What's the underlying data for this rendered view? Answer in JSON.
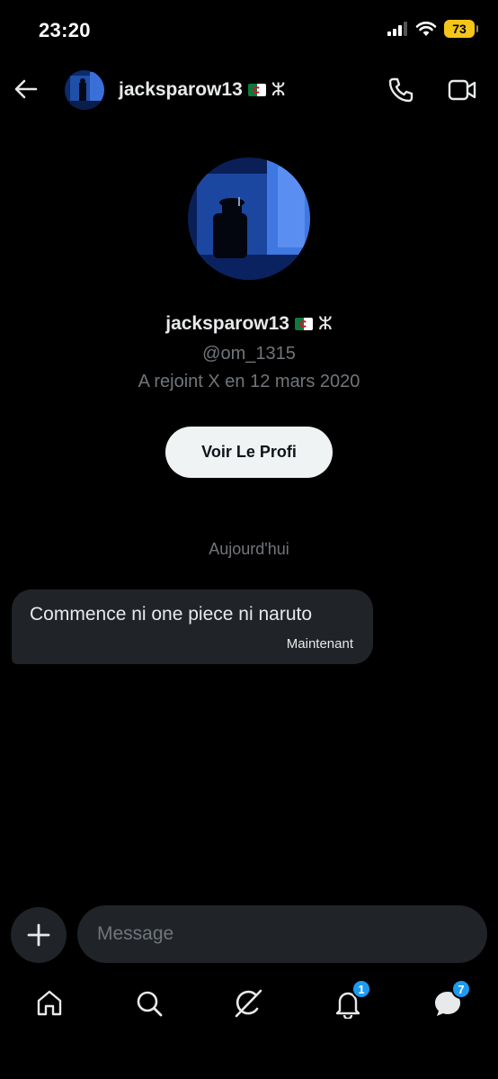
{
  "status_bar": {
    "time": "23:20",
    "battery": "73",
    "icons": [
      "signal-icon",
      "wifi-icon",
      "battery-icon"
    ]
  },
  "header": {
    "name": "jacksparow13",
    "flag": "algeria-flag",
    "symbol": "ⵣ",
    "icons": [
      "back-arrow-icon",
      "phone-icon",
      "video-icon"
    ]
  },
  "profile": {
    "name": "jacksparow13",
    "symbol": "ⵣ",
    "handle": "@om_1315",
    "joined": "A rejoint X en 12 mars 2020",
    "view_button": "Voir Le Profi"
  },
  "conversation": {
    "date_divider": "Aujourd'hui",
    "messages": [
      {
        "text": "Commence ni one piece ni naruto",
        "time": "Maintenant"
      }
    ]
  },
  "composer": {
    "placeholder": "Message",
    "add_icon": "plus-icon"
  },
  "bottom_nav": {
    "items": [
      {
        "icon": "home-icon"
      },
      {
        "icon": "search-icon"
      },
      {
        "icon": "grok-icon"
      },
      {
        "icon": "bell-icon",
        "badge": "1"
      },
      {
        "icon": "messages-icon",
        "badge": "7"
      }
    ]
  },
  "colors": {
    "background": "#000000",
    "text_primary": "#e7e9ea",
    "text_secondary": "#71767b",
    "bubble": "#202327",
    "accent": "#1d9bf0",
    "battery": "#f5c518"
  }
}
